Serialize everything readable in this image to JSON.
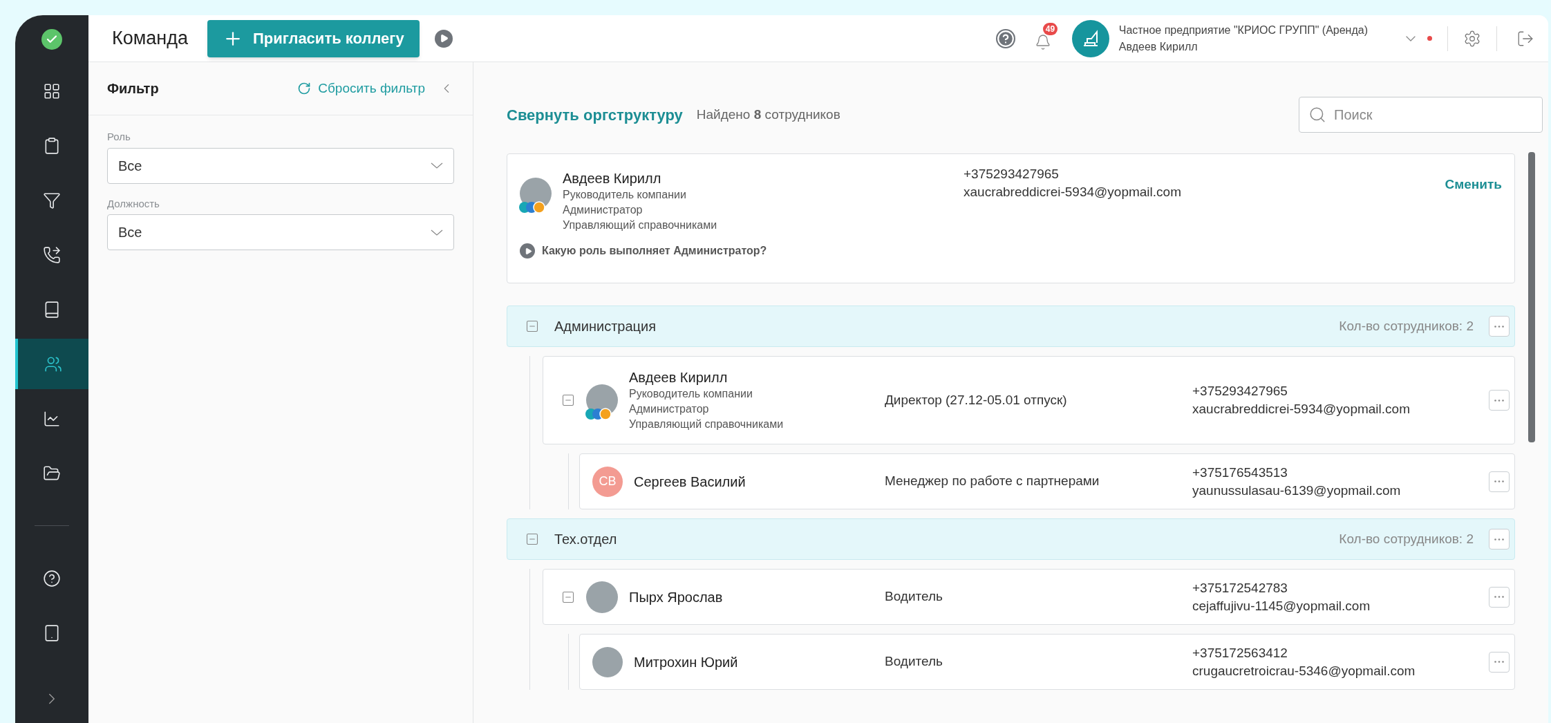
{
  "header": {
    "title": "Команда",
    "invite_button": "Пригласить коллегу",
    "notifications": "49",
    "company": "Частное предприятие \"КРИОС ГРУПП\" (Аренда)",
    "user": "Авдеев Кирилл"
  },
  "sidebar": {
    "items": [
      {
        "kind": "grid",
        "selected": false
      },
      {
        "kind": "clipboard",
        "selected": false
      },
      {
        "kind": "funnel",
        "selected": false
      },
      {
        "kind": "phone",
        "selected": false
      },
      {
        "kind": "book",
        "selected": false
      },
      {
        "kind": "team",
        "selected": true
      },
      {
        "kind": "chart",
        "selected": false
      },
      {
        "kind": "folder",
        "selected": false
      }
    ],
    "bottom_items": [
      {
        "kind": "help",
        "selected": false
      },
      {
        "kind": "tablet",
        "selected": false
      }
    ]
  },
  "filter": {
    "title": "Фильтр",
    "reset": "Сбросить фильтр",
    "fields": [
      {
        "label": "Роль",
        "value": "Все"
      },
      {
        "label": "Должность",
        "value": "Все"
      }
    ]
  },
  "main": {
    "collapse_link": "Свернуть оргструктуру",
    "found": "Найдено **8** сотрудников",
    "search": {
      "placeholder": "Поиск"
    },
    "current_user": {
      "name": "Авдеев Кирилл",
      "roles": [
        "Руководитель компании",
        "Администратор",
        "Управляющий справочниками"
      ],
      "phone": "+375293427965",
      "email": "xaucrabreddicrei-5934@yopmail.com",
      "change_link": "Сменить",
      "hint": "Какую роль выполняет Администратор?",
      "role_badges": true
    },
    "departments": [
      {
        "name": "Администрация",
        "expanded": true,
        "count": "Кол-во сотрудников: 2",
        "employees": [
          {
            "name": "Авдеев Кирилл",
            "roles": [
              "Руководитель компании",
              "Администратор",
              "Управляющий справочниками"
            ],
            "role_badges": true,
            "position": "Директор (27.12-05.01 отпуск)",
            "phone": "+375293427965",
            "email": "xaucrabreddicrei-5934@yopmail.com",
            "expanded": true,
            "children": [
              {
                "name": "Сергеев Василий",
                "initials": "СВ",
                "position": "Менеджер по работе с партнерами",
                "phone": "+375176543513",
                "email": "yaunussulasau-6139@yopmail.com"
              }
            ]
          }
        ]
      },
      {
        "name": "Тех.отдел",
        "expanded": true,
        "count": "Кол-во сотрудников: 2",
        "employees": [
          {
            "name": "Пырх Ярослав",
            "position": "Водитель",
            "phone": "+375172542783",
            "email": "cejaffujivu-1145@yopmail.com",
            "expanded": true,
            "children": [
              {
                "name": "Митрохин Юрий",
                "position": "Водитель",
                "phone": "+375172563412",
                "email": "crugaucretroicrau-5346@yopmail.com"
              }
            ]
          }
        ]
      }
    ]
  }
}
